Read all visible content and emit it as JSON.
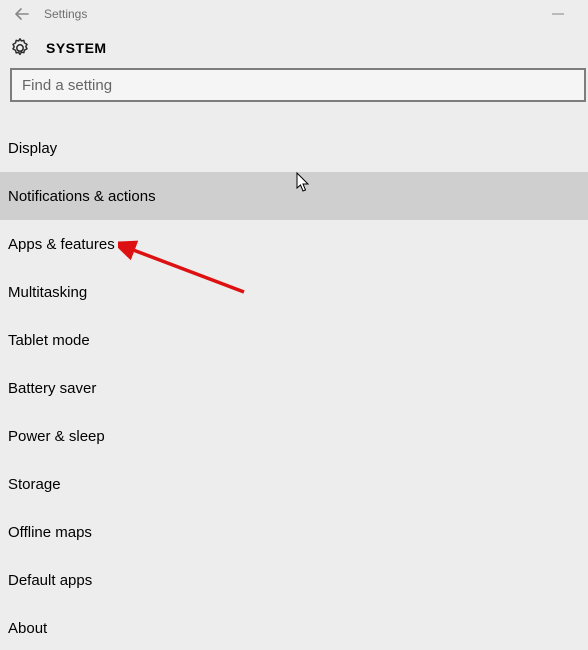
{
  "window": {
    "title": "Settings"
  },
  "header": {
    "title": "SYSTEM"
  },
  "search": {
    "placeholder": "Find a setting",
    "value": ""
  },
  "menu": {
    "items": [
      {
        "label": "Display"
      },
      {
        "label": "Notifications & actions"
      },
      {
        "label": "Apps & features"
      },
      {
        "label": "Multitasking"
      },
      {
        "label": "Tablet mode"
      },
      {
        "label": "Battery saver"
      },
      {
        "label": "Power & sleep"
      },
      {
        "label": "Storage"
      },
      {
        "label": "Offline maps"
      },
      {
        "label": "Default apps"
      },
      {
        "label": "About"
      }
    ],
    "hovered_index": 1
  }
}
